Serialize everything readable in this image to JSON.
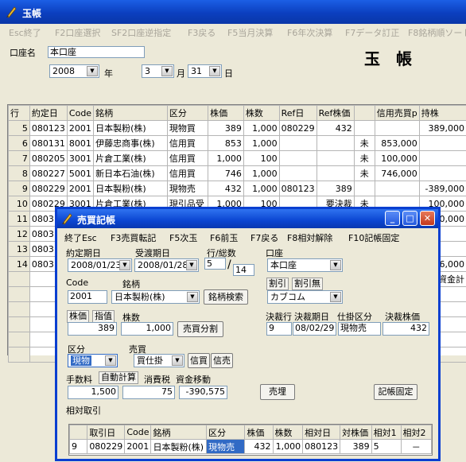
{
  "main": {
    "title": "玉帳",
    "menu": [
      "Esc終了",
      "F2口座選択",
      "SF2口座逆指定",
      "F3戻る",
      "F5当月決算",
      "F6年次決算",
      "F7データ訂正",
      "F8銘柄順ソート"
    ],
    "account_label": "口座名",
    "account_value": "本口座",
    "year": "2008",
    "year_unit": "年",
    "month": "3",
    "month_unit": "月",
    "day": "31",
    "day_unit": "日",
    "big_title": "玉　帳",
    "grid": {
      "headers": [
        "行",
        "約定日",
        "Code",
        "銘柄",
        "区分",
        "株価",
        "株数",
        "Ref日",
        "Ref株価",
        "",
        "信用売買p",
        "持株"
      ],
      "rows": [
        [
          "5",
          "080123",
          "2001",
          "日本製粉(株)",
          "現物買",
          "389",
          "1,000",
          "080229",
          "432",
          "",
          "",
          "389,000"
        ],
        [
          "6",
          "080131",
          "8001",
          "伊藤忠商事(株)",
          "信用買",
          "853",
          "1,000",
          "",
          "",
          "未",
          "853,000",
          ""
        ],
        [
          "7",
          "080205",
          "3001",
          "片倉工業(株)",
          "信用買",
          "1,000",
          "100",
          "",
          "",
          "未",
          "100,000",
          ""
        ],
        [
          "8",
          "080227",
          "5001",
          "新日本石油(株)",
          "信用買",
          "746",
          "1,000",
          "",
          "",
          "未",
          "746,000",
          ""
        ],
        [
          "9",
          "080229",
          "2001",
          "日本製粉(株)",
          "現物売",
          "432",
          "1,000",
          "080123",
          "389",
          "",
          "",
          "-389,000"
        ],
        [
          "10",
          "080229",
          "3001",
          "片倉工業(株)",
          "現引品受",
          "1,000",
          "100",
          "",
          "要決裁",
          "未",
          "",
          "100,000"
        ],
        [
          "11",
          "0803",
          "",
          "",
          "",
          "",
          "",
          "",
          "",
          "",
          "",
          "100,000"
        ],
        [
          "12",
          "0803",
          "",
          "",
          "",
          "",
          "",
          "",
          "",
          "",
          "",
          ""
        ],
        [
          "13",
          "0803",
          "",
          "",
          "",
          "",
          "",
          "",
          "",
          "",
          "",
          ""
        ],
        [
          "14",
          "0803",
          "",
          "",
          "",
          "",
          "",
          "",
          "",
          "",
          "",
          "6,000"
        ],
        [
          "",
          "",
          "",
          "",
          "",
          "",
          "",
          "",
          "",
          "",
          "",
          "資金計"
        ],
        [
          "",
          "",
          "",
          "",
          "",
          "",
          "",
          "",
          "",
          "",
          "",
          ""
        ],
        [
          "",
          "",
          "",
          "",
          "",
          "",
          "",
          "",
          "",
          "",
          "",
          ""
        ],
        [
          "",
          "",
          "",
          "",
          "",
          "",
          "",
          "",
          "",
          "",
          "",
          ""
        ],
        [
          "",
          "",
          "",
          "",
          "",
          "",
          "",
          "",
          "",
          "",
          "",
          ""
        ],
        [
          "",
          "",
          "",
          "",
          "",
          "",
          "",
          "",
          "",
          "",
          "",
          ""
        ]
      ]
    }
  },
  "dialog": {
    "title": "売買記帳",
    "menu": [
      "終了Esc",
      "F3売買転記",
      "F5次玉",
      "F6前玉",
      "F7戻る",
      "F8相対解除",
      "F10記帳固定"
    ],
    "labels": {
      "trade_date": "約定期日",
      "settle_date": "受渡期日",
      "row_total": "行/総数",
      "account": "口座",
      "code": "Code",
      "name": "銘柄",
      "discount": "割引",
      "discount_none": "割引無",
      "price": "株価",
      "limit": "指值",
      "shares": "株数",
      "settle_row": "決裁行",
      "settle_date2": "決裁期日",
      "settle_type": "仕掛区分",
      "settle_price": "決裁株価",
      "kubun": "区分",
      "baibai": "売買",
      "fee": "手数料",
      "auto_calc": "自動計算",
      "tax": "消費税",
      "fund_move": "資金移動",
      "relative": "相対取引"
    },
    "values": {
      "trade_date": "2008/01/23",
      "settle_date": "2008/01/28",
      "row": "5",
      "total": "14",
      "account": "本口座",
      "code": "2001",
      "name": "日本製粉(株)",
      "broker": "カブコム",
      "price": "389",
      "shares": "1,000",
      "settle_row": "9",
      "settle_date2": "08/02/29",
      "settle_type": "現物売",
      "settle_price": "432",
      "kubun": "現物",
      "baibai": "買仕掛",
      "fee": "1,500",
      "tax": "75",
      "fund_move": "-390,575"
    },
    "buttons": {
      "search": "銘柄検索",
      "split": "売買分割",
      "credit_buy": "信買",
      "credit_sell": "信売",
      "sell": "売埋",
      "fix": "記帳固定"
    },
    "sub_grid": {
      "headers": [
        "",
        "取引日",
        "Code",
        "銘柄",
        "区分",
        "株価",
        "株数",
        "相対日",
        "対株価",
        "相対1",
        "相対2"
      ],
      "row": [
        "9",
        "080229",
        "2001",
        "日本製粉(株)",
        "現物売",
        "432",
        "1,000",
        "080123",
        "389",
        "5",
        "－"
      ]
    }
  },
  "colors": {
    "titlebar": "#0b46d2",
    "selection": "#316ac5"
  }
}
